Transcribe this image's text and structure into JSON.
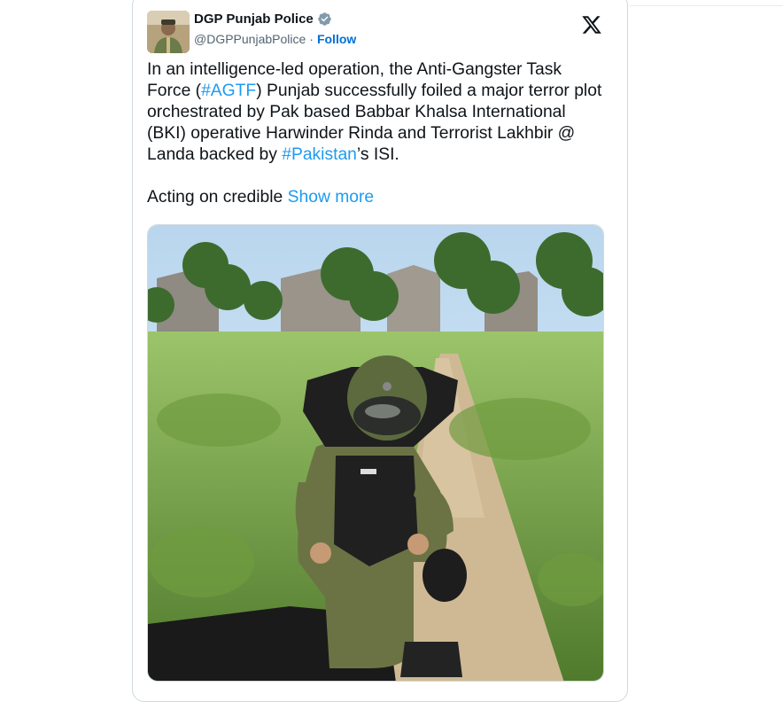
{
  "author": {
    "name": "DGP Punjab Police",
    "handle": "@DGPPunjabPolice",
    "separator": "·",
    "follow_label": "Follow",
    "verified_icon": "verified-badge-icon"
  },
  "platform_icon": "x-logo-icon",
  "tweet": {
    "p1_a": "In an intelligence-led operation, the Anti-Gangster Task Force (",
    "hashtag1": "#AGTF",
    "p1_b": ") Punjab successfully foiled a major terror plot orchestrated by Pak based Babbar Khalsa International (BKI) operative Harwinder Rinda and Terrorist Lakhbir @ Landa backed by ",
    "hashtag2": "#Pakistan",
    "p1_c": "’s ISI.",
    "p2": "Acting on credible ",
    "show_more": "Show more"
  },
  "colors": {
    "link": "#1d9bf0",
    "text": "#0f1419",
    "muted": "#536471",
    "border": "#cfd9de"
  }
}
